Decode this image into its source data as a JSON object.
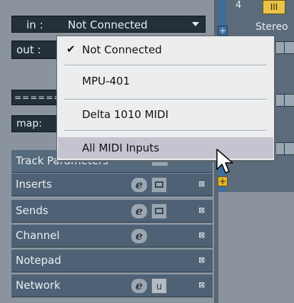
{
  "input": {
    "label": "in :",
    "value": "Not Connected"
  },
  "output": {
    "label": "out :"
  },
  "dash_field": {
    "text": "======"
  },
  "map_field": {
    "label": "map:"
  },
  "sections": [
    {
      "title": "Track Parameters"
    },
    {
      "title": "Inserts"
    },
    {
      "title": "Sends"
    },
    {
      "title": "Channel"
    },
    {
      "title": "Notepad"
    },
    {
      "title": "Network",
      "u_label": "u"
    }
  ],
  "track": {
    "number": "4",
    "badge": "III",
    "output_text": "Stereo"
  },
  "menu": {
    "items": [
      {
        "label": "Not Connected",
        "checked": true
      },
      {
        "label": "MPU-401",
        "checked": false
      },
      {
        "label": "Delta 1010 MIDI",
        "checked": false
      },
      {
        "label": "All MIDI Inputs",
        "checked": false,
        "highlighted": true
      }
    ],
    "check_glyph": "✔"
  },
  "colors": {
    "panel": "#8b949e",
    "field_dark": "#23303a",
    "section": "#4f6275",
    "menu_bg": "#ecedee",
    "menu_highlight": "#c6c3d0",
    "track_blue": "#3c6e9e",
    "accent_yellow": "#e9c249"
  }
}
